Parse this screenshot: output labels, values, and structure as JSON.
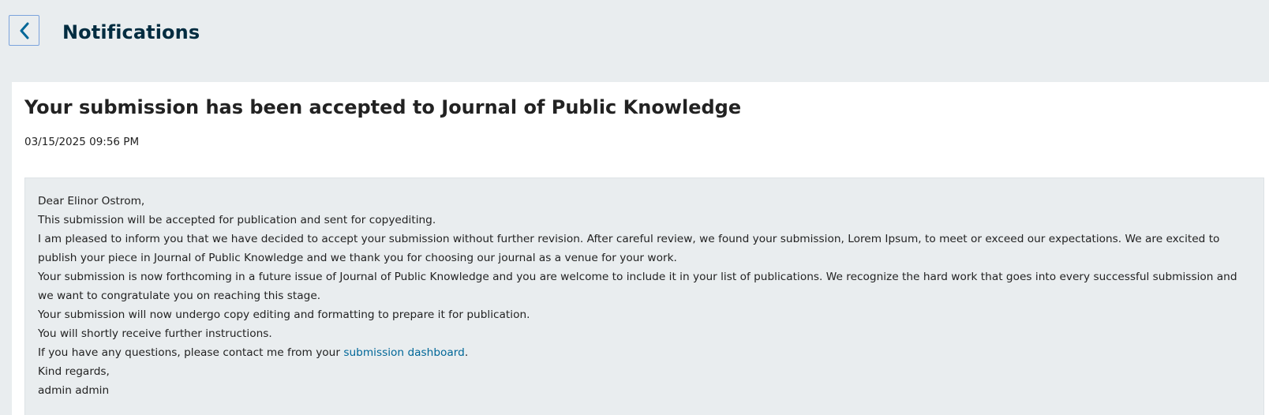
{
  "header": {
    "back_icon": "chevron-left-icon",
    "title": "Notifications"
  },
  "notification": {
    "title": "Your submission has been accepted to Journal of Public Knowledge",
    "date": "03/15/2025 09:56 PM",
    "body": {
      "greeting": "Dear Elinor Ostrom,",
      "line1": "This submission will be accepted for publication and sent for copyediting.",
      "line2": "I am pleased to inform you that we have decided to accept your submission without further revision. After careful review, we found your submission, Lorem Ipsum, to meet or exceed our expectations. We are excited to publish your piece in Journal of Public Knowledge and we thank you for choosing our journal as a venue for your work.",
      "line3": "Your submission is now forthcoming in a future issue of Journal of Public Knowledge and you are welcome to include it in your list of publications. We recognize the hard work that goes into every successful submission and we want to congratulate you on reaching this stage.",
      "line4": "Your submission will now undergo copy editing and formatting to prepare it for publication.",
      "line5": "You will shortly receive further instructions.",
      "line6_prefix": "If you have any questions, please contact me from your ",
      "line6_link": "submission dashboard",
      "line6_suffix": ".",
      "closing": "Kind regards,",
      "signature": "admin admin"
    }
  },
  "colors": {
    "background": "#e9edef",
    "title": "#002c40",
    "link": "#006798",
    "back_border": "#7ba3dc"
  }
}
